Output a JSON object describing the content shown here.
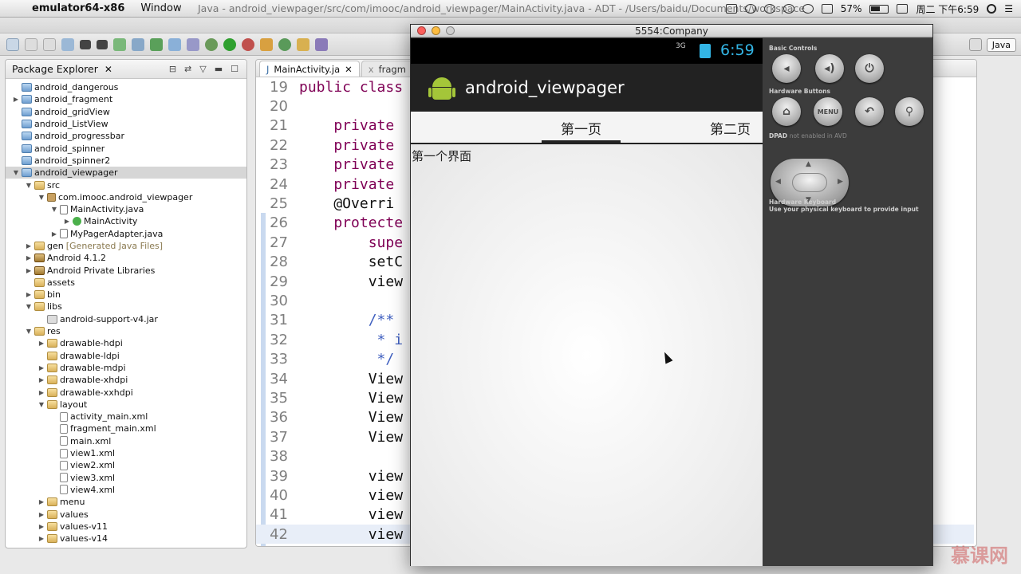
{
  "menubar": {
    "app_name": "emulator64-x86",
    "menus": [
      "Window"
    ],
    "window_title": "Java - android_viewpager/src/com/imooc/android_viewpager/MainActivity.java - ADT - /Users/baidu/Documents/workspace",
    "battery": "57%",
    "clock": "周二 下午6:59"
  },
  "toolbar": {
    "perspective": "Java"
  },
  "package_explorer": {
    "title": "Package Explorer",
    "items": [
      {
        "label": "android_dangerous",
        "indent": 0,
        "twisty": "",
        "icon": "proj"
      },
      {
        "label": "android_fragment",
        "indent": 0,
        "twisty": "▶",
        "icon": "proj"
      },
      {
        "label": "android_gridView",
        "indent": 0,
        "twisty": "",
        "icon": "proj"
      },
      {
        "label": "android_ListView",
        "indent": 0,
        "twisty": "",
        "icon": "proj"
      },
      {
        "label": "android_progressbar",
        "indent": 0,
        "twisty": "",
        "icon": "proj"
      },
      {
        "label": "android_spinner",
        "indent": 0,
        "twisty": "",
        "icon": "proj"
      },
      {
        "label": "android_spinner2",
        "indent": 0,
        "twisty": "",
        "icon": "proj"
      },
      {
        "label": "android_viewpager",
        "indent": 0,
        "twisty": "▼",
        "icon": "proj",
        "selected": true
      },
      {
        "label": "src",
        "indent": 1,
        "twisty": "▼",
        "icon": "folder"
      },
      {
        "label": "com.imooc.android_viewpager",
        "indent": 2,
        "twisty": "▼",
        "icon": "pkgi"
      },
      {
        "label": "MainActivity.java",
        "indent": 3,
        "twisty": "▼",
        "icon": "java"
      },
      {
        "label": "MainActivity",
        "indent": 4,
        "twisty": "▶",
        "icon": "cls"
      },
      {
        "label": "MyPagerAdapter.java",
        "indent": 3,
        "twisty": "▶",
        "icon": "java"
      },
      {
        "label": "gen",
        "indent": 1,
        "twisty": "▶",
        "icon": "folder",
        "suffix": "[Generated Java Files]"
      },
      {
        "label": "Android 4.1.2",
        "indent": 1,
        "twisty": "▶",
        "icon": "lib"
      },
      {
        "label": "Android Private Libraries",
        "indent": 1,
        "twisty": "▶",
        "icon": "lib"
      },
      {
        "label": "assets",
        "indent": 1,
        "twisty": "",
        "icon": "folder"
      },
      {
        "label": "bin",
        "indent": 1,
        "twisty": "▶",
        "icon": "folder"
      },
      {
        "label": "libs",
        "indent": 1,
        "twisty": "▼",
        "icon": "folder"
      },
      {
        "label": "android-support-v4.jar",
        "indent": 2,
        "twisty": "",
        "icon": "jar"
      },
      {
        "label": "res",
        "indent": 1,
        "twisty": "▼",
        "icon": "folder"
      },
      {
        "label": "drawable-hdpi",
        "indent": 2,
        "twisty": "▶",
        "icon": "folder"
      },
      {
        "label": "drawable-ldpi",
        "indent": 2,
        "twisty": "",
        "icon": "folder"
      },
      {
        "label": "drawable-mdpi",
        "indent": 2,
        "twisty": "▶",
        "icon": "folder"
      },
      {
        "label": "drawable-xhdpi",
        "indent": 2,
        "twisty": "▶",
        "icon": "folder"
      },
      {
        "label": "drawable-xxhdpi",
        "indent": 2,
        "twisty": "▶",
        "icon": "folder"
      },
      {
        "label": "layout",
        "indent": 2,
        "twisty": "▼",
        "icon": "folder"
      },
      {
        "label": "activity_main.xml",
        "indent": 3,
        "twisty": "",
        "icon": "xml"
      },
      {
        "label": "fragment_main.xml",
        "indent": 3,
        "twisty": "",
        "icon": "xml"
      },
      {
        "label": "main.xml",
        "indent": 3,
        "twisty": "",
        "icon": "xml"
      },
      {
        "label": "view1.xml",
        "indent": 3,
        "twisty": "",
        "icon": "xml"
      },
      {
        "label": "view2.xml",
        "indent": 3,
        "twisty": "",
        "icon": "xml"
      },
      {
        "label": "view3.xml",
        "indent": 3,
        "twisty": "",
        "icon": "xml"
      },
      {
        "label": "view4.xml",
        "indent": 3,
        "twisty": "",
        "icon": "xml"
      },
      {
        "label": "menu",
        "indent": 2,
        "twisty": "▶",
        "icon": "folder"
      },
      {
        "label": "values",
        "indent": 2,
        "twisty": "▶",
        "icon": "folder"
      },
      {
        "label": "values-v11",
        "indent": 2,
        "twisty": "▶",
        "icon": "folder"
      },
      {
        "label": "values-v14",
        "indent": 2,
        "twisty": "▶",
        "icon": "folder"
      }
    ]
  },
  "editor": {
    "tabs": [
      {
        "label": "MainActivity.ja",
        "active": true
      },
      {
        "label": "fragm",
        "active": false
      }
    ],
    "lines": [
      {
        "num": "19",
        "kw": "public class",
        "rest": ""
      },
      {
        "num": "20",
        "kw": "",
        "rest": ""
      },
      {
        "num": "21",
        "kw": "    private",
        "rest": ""
      },
      {
        "num": "22",
        "kw": "    private",
        "rest": ""
      },
      {
        "num": "23",
        "kw": "    private",
        "rest": ""
      },
      {
        "num": "24",
        "kw": "    private",
        "rest": ""
      },
      {
        "num": "25",
        "kw": "",
        "rest": "    @Overri"
      },
      {
        "num": "26",
        "kw": "    protecte",
        "rest": ""
      },
      {
        "num": "27",
        "kw": "        supe",
        "rest": ""
      },
      {
        "num": "28",
        "kw": "",
        "rest": "        setC"
      },
      {
        "num": "29",
        "kw": "",
        "rest": "        view"
      },
      {
        "num": "30",
        "kw": "",
        "rest": ""
      },
      {
        "num": "31",
        "kw": "",
        "rest": "",
        "cmt": "        /**"
      },
      {
        "num": "32",
        "kw": "",
        "rest": "",
        "cmt": "         * i"
      },
      {
        "num": "33",
        "kw": "",
        "rest": "",
        "cmt": "         */"
      },
      {
        "num": "34",
        "kw": "",
        "rest": "        View"
      },
      {
        "num": "35",
        "kw": "",
        "rest": "        View"
      },
      {
        "num": "36",
        "kw": "",
        "rest": "        View"
      },
      {
        "num": "37",
        "kw": "",
        "rest": "        View"
      },
      {
        "num": "38",
        "kw": "",
        "rest": ""
      },
      {
        "num": "39",
        "kw": "",
        "rest": "        view"
      },
      {
        "num": "40",
        "kw": "",
        "rest": "        view"
      },
      {
        "num": "41",
        "kw": "",
        "rest": "        view"
      },
      {
        "num": "42",
        "kw": "",
        "rest": "        view",
        "current": true
      }
    ]
  },
  "emulator": {
    "window_title": "5554:Company",
    "status": {
      "signal": "3G",
      "time": "6:59"
    },
    "app_title": "android_viewpager",
    "tabs": [
      "第一页",
      "第二页"
    ],
    "page_text": "第一个界面",
    "controls": {
      "basic_controls": "Basic Controls",
      "hardware_buttons": "Hardware Buttons",
      "menu_label": "MENU",
      "dpad": "DPAD",
      "dpad_note": "not enabled in AVD",
      "hardware_keyboard": "Hardware Keyboard",
      "keyboard_note": "Use your physical keyboard to provide input"
    }
  },
  "watermark": "慕课网",
  "colors": {
    "android_green": "#a4c639",
    "holo_blue": "#33b5e5",
    "keyword": "#7f0055",
    "comment": "#3f5fbf"
  }
}
